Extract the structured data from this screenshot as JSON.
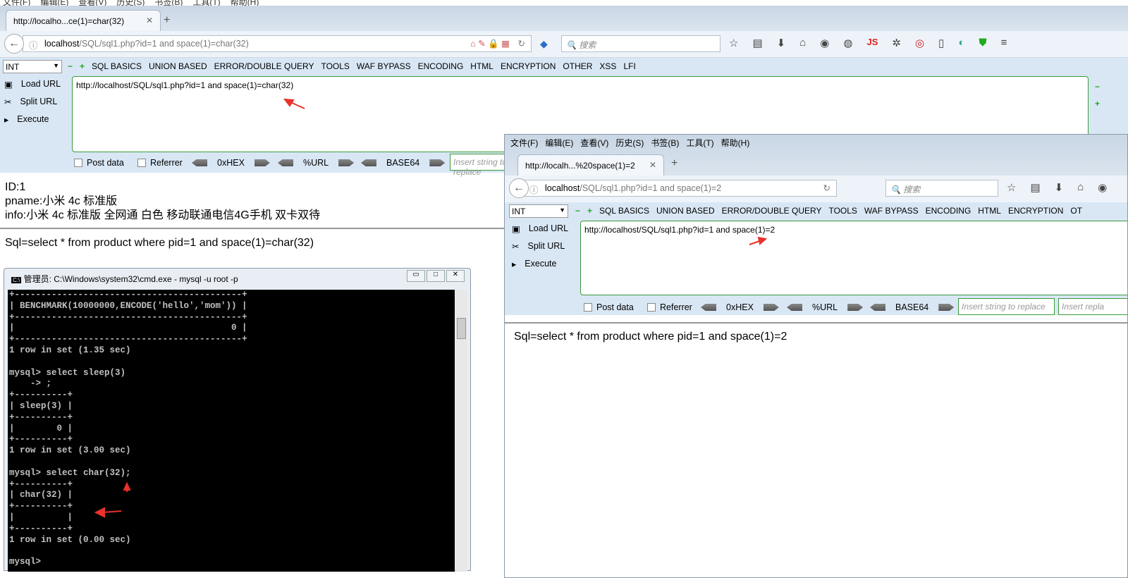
{
  "menubar": [
    "文件(F)",
    "编辑(E)",
    "查看(V)",
    "历史(S)",
    "书签(B)",
    "工具(T)",
    "帮助(H)"
  ],
  "browser1": {
    "tab_title": "http://localho...ce(1)=char(32)",
    "url_host": "localhost",
    "url_path": "/SQL/sql1.php?id=1 and space(1)=char(32)",
    "search_placeholder": "搜索",
    "hackbar": {
      "select": "INT",
      "menus": [
        "SQL BASICS",
        "UNION BASED",
        "ERROR/DOUBLE QUERY",
        "TOOLS",
        "WAF BYPASS",
        "ENCODING",
        "HTML",
        "ENCRYPTION",
        "OTHER",
        "XSS",
        "LFI"
      ],
      "load": "Load URL",
      "split": "Split URL",
      "execute": "Execute",
      "textarea": "http://localhost/SQL/sql1.php?id=1 and space(1)=char(32)",
      "post": "Post data",
      "referrer": "Referrer",
      "hex": "0xHEX",
      "urlenc": "%URL",
      "base64": "BASE64",
      "insert_placeholder": "Insert string to replace"
    },
    "content": {
      "id": "ID:1",
      "pname": "pname:小米 4c 标准版",
      "info": "info:小米 4c 标准版 全网通 白色 移动联通电信4G手机 双卡双待",
      "sql": "Sql=select * from product where pid=1 and space(1)=char(32)"
    }
  },
  "cmd": {
    "title": "管理员: C:\\Windows\\system32\\cmd.exe - mysql  -u root -p",
    "output": "+-------------------------------------------+\n| BENCHMARK(10000000,ENCODE('hello','mom')) |\n+-------------------------------------------+\n|                                         0 |\n+-------------------------------------------+\n1 row in set (1.35 sec)\n\nmysql> select sleep(3)\n    -> ;\n+----------+\n| sleep(3) |\n+----------+\n|        0 |\n+----------+\n1 row in set (3.00 sec)\n\nmysql> select char(32);\n+----------+\n| char(32) |\n+----------+\n|          |\n+----------+\n1 row in set (0.00 sec)\n\nmysql>"
  },
  "browser2": {
    "menubar": [
      "文件(F)",
      "编辑(E)",
      "查看(V)",
      "历史(S)",
      "书签(B)",
      "工具(T)",
      "帮助(H)"
    ],
    "tab_title": "http://localh...%20space(1)=2",
    "url_host": "localhost",
    "url_path": "/SQL/sql1.php?id=1 and space(1)=2",
    "search_placeholder": "搜索",
    "hackbar": {
      "select": "INT",
      "menus": [
        "SQL BASICS",
        "UNION BASED",
        "ERROR/DOUBLE QUERY",
        "TOOLS",
        "WAF BYPASS",
        "ENCODING",
        "HTML",
        "ENCRYPTION",
        "OT"
      ],
      "load": "Load URL",
      "split": "Split URL",
      "execute": "Execute",
      "textarea": "http://localhost/SQL/sql1.php?id=1 and space(1)=2",
      "post": "Post data",
      "referrer": "Referrer",
      "hex": "0xHEX",
      "urlenc": "%URL",
      "base64": "BASE64",
      "insert_placeholder": "Insert string to replace",
      "insert_placeholder2": "Insert repla"
    },
    "content": {
      "sql": "Sql=select * from product where pid=1 and space(1)=2"
    }
  },
  "colors": {
    "annotation_arrow": "#e8322a",
    "hackbar_bg": "#d9e7f5",
    "textarea_border": "#3a9a3a"
  }
}
